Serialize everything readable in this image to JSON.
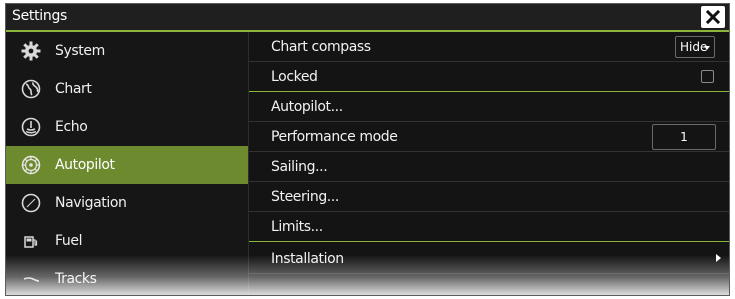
{
  "window": {
    "title": "Settings"
  },
  "sidebar": {
    "items": [
      {
        "label": "System",
        "icon": "gear-icon",
        "active": false
      },
      {
        "label": "Chart",
        "icon": "globe-icon",
        "active": false
      },
      {
        "label": "Echo",
        "icon": "sonar-icon",
        "active": false
      },
      {
        "label": "Autopilot",
        "icon": "steering-wheel-icon",
        "active": true
      },
      {
        "label": "Navigation",
        "icon": "compass-icon",
        "active": false
      },
      {
        "label": "Fuel",
        "icon": "fuel-pump-icon",
        "active": false
      },
      {
        "label": "Tracks",
        "icon": "tracks-icon",
        "active": false
      }
    ]
  },
  "main": {
    "chart_compass": {
      "label": "Chart compass",
      "value": "Hide"
    },
    "locked": {
      "label": "Locked",
      "checked": false
    },
    "autopilot": {
      "label": "Autopilot..."
    },
    "performance_mode": {
      "label": "Performance mode",
      "value": "1"
    },
    "sailing": {
      "label": "Sailing..."
    },
    "steering": {
      "label": "Steering..."
    },
    "limits": {
      "label": "Limits..."
    },
    "installation": {
      "label": "Installation"
    }
  },
  "colors": {
    "accent": "#8cb53b",
    "active_item_bg": "#6e8a2e",
    "panel_bg": "#141414"
  }
}
